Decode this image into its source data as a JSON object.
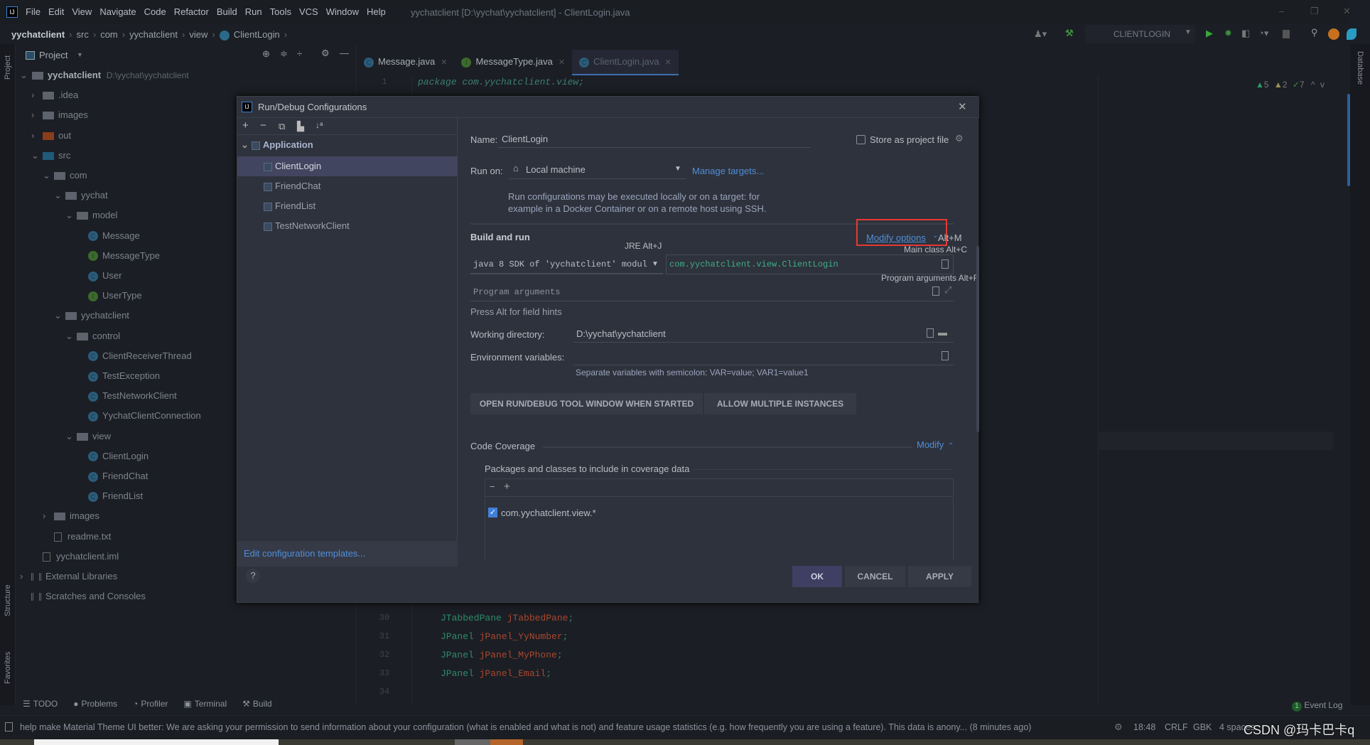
{
  "app": {
    "title": "yychatclient [D:\\yychat\\yychatclient] - ClientLogin.java",
    "logo": "IJ"
  },
  "menu": [
    "File",
    "Edit",
    "View",
    "Navigate",
    "Code",
    "Refactor",
    "Build",
    "Run",
    "Tools",
    "VCS",
    "Window",
    "Help"
  ],
  "breadcrumb": [
    "yychatclient",
    "src",
    "com",
    "yychatclient",
    "view",
    "ClientLogin"
  ],
  "toolbar": {
    "run_config": "CLIENTLOGIN"
  },
  "window_controls": {
    "minimize": "–",
    "restore": "❐",
    "close": "✕"
  },
  "project": {
    "title": "Project",
    "strip_label": "Project",
    "root": "yychatclient",
    "root_path": "D:\\yychat\\yychatclient",
    "tree": [
      {
        "label": ".idea",
        "indent": 1,
        "kind": "folder",
        "arrow": ">"
      },
      {
        "label": "images",
        "indent": 1,
        "kind": "folder",
        "arrow": ">"
      },
      {
        "label": "out",
        "indent": 1,
        "kind": "folder-out",
        "arrow": ">"
      },
      {
        "label": "src",
        "indent": 1,
        "kind": "folder-src",
        "arrow": "v"
      },
      {
        "label": "com",
        "indent": 2,
        "kind": "package",
        "arrow": "v"
      },
      {
        "label": "yychat",
        "indent": 3,
        "kind": "package",
        "arrow": "v"
      },
      {
        "label": "model",
        "indent": 4,
        "kind": "package",
        "arrow": "v"
      },
      {
        "label": "Message",
        "indent": 5,
        "kind": "class"
      },
      {
        "label": "MessageType",
        "indent": 5,
        "kind": "interface"
      },
      {
        "label": "User",
        "indent": 5,
        "kind": "class"
      },
      {
        "label": "UserType",
        "indent": 5,
        "kind": "interface"
      },
      {
        "label": "yychatclient",
        "indent": 3,
        "kind": "package",
        "arrow": "v"
      },
      {
        "label": "control",
        "indent": 4,
        "kind": "package",
        "arrow": "v"
      },
      {
        "label": "ClientReceiverThread",
        "indent": 5,
        "kind": "class"
      },
      {
        "label": "TestException",
        "indent": 5,
        "kind": "class"
      },
      {
        "label": "TestNetworkClient",
        "indent": 5,
        "kind": "class"
      },
      {
        "label": "YychatClientConnection",
        "indent": 5,
        "kind": "class"
      },
      {
        "label": "view",
        "indent": 4,
        "kind": "package",
        "arrow": "v"
      },
      {
        "label": "ClientLogin",
        "indent": 5,
        "kind": "class"
      },
      {
        "label": "FriendChat",
        "indent": 5,
        "kind": "class"
      },
      {
        "label": "FriendList",
        "indent": 5,
        "kind": "class"
      },
      {
        "label": "images",
        "indent": 2,
        "kind": "package",
        "arrow": ">"
      },
      {
        "label": "readme.txt",
        "indent": 2,
        "kind": "file"
      },
      {
        "label": "yychatclient.iml",
        "indent": 1,
        "kind": "file"
      },
      {
        "label": "External Libraries",
        "indent": 0,
        "kind": "lib",
        "arrow": ">"
      },
      {
        "label": "Scratches and Consoles",
        "indent": 0,
        "kind": "lib"
      }
    ]
  },
  "side_labels": {
    "structure": "Structure",
    "favorites": "Favorites",
    "database": "Database"
  },
  "editor": {
    "tabs": [
      {
        "label": "Message.java",
        "icon": "C"
      },
      {
        "label": "MessageType.java",
        "icon": "I"
      },
      {
        "label": "ClientLogin.java",
        "icon": "C",
        "active": true
      }
    ],
    "inspections": {
      "warnings": "5",
      "weak_warnings": "2",
      "typos": "7"
    },
    "lines": [
      {
        "n": "1",
        "parts": [
          [
            "pk",
            "package com.yychatclient.view;"
          ]
        ]
      },
      {
        "n": "30",
        "parts": [
          [
            "ty",
            "JTabbedPane "
          ],
          [
            "va",
            "jTabbedPane"
          ],
          [
            "pk",
            ";"
          ]
        ]
      },
      {
        "n": "31",
        "parts": [
          [
            "ty",
            "JPanel "
          ],
          [
            "va",
            "jPanel_YyNumber"
          ],
          [
            "pk",
            ";"
          ]
        ]
      },
      {
        "n": "32",
        "parts": [
          [
            "ty",
            "JPanel "
          ],
          [
            "va",
            "jPanel_MyPhone"
          ],
          [
            "pk",
            ";"
          ]
        ]
      },
      {
        "n": "33",
        "parts": [
          [
            "ty",
            "JPanel "
          ],
          [
            "va",
            "jPanel_Email"
          ],
          [
            "pk",
            ";"
          ]
        ]
      },
      {
        "n": "34",
        "parts": []
      }
    ]
  },
  "dialog": {
    "title": "Run/Debug Configurations",
    "group": "Application",
    "configs": [
      "ClientLogin",
      "FriendChat",
      "FriendList",
      "TestNetworkClient"
    ],
    "selected": "ClientLogin",
    "edit_templates": "Edit configuration templates...",
    "name_label": "Name:",
    "name_value": "ClientLogin",
    "store_label": "Store as project file",
    "store_checked": false,
    "run_on_label": "Run on:",
    "run_on_value": "Local machine",
    "manage_targets": "Manage targets...",
    "run_on_info_1": "Run configurations may be executed locally or on a target: for",
    "run_on_info_2": "example in a Docker Container or on a remote host using SSH.",
    "build_run": "Build and run",
    "modify_options": "Modify options",
    "modify_shortcut": "Alt+M",
    "jre_hint": "JRE Alt+J",
    "main_class_hint": "Main class Alt+C",
    "prog_args_hint": "Program arguments Alt+R",
    "jre_value": "java 8 SDK of 'yychatclient' module",
    "main_class": "com.yychatclient.view.ClientLogin",
    "prog_args_placeholder": "Program arguments",
    "press_alt": "Press Alt for field hints",
    "workdir_label": "Working directory:",
    "workdir_value": "D:\\yychat\\yychatclient",
    "env_label": "Environment variables:",
    "env_hint": "Separate variables with semicolon: VAR=value; VAR1=value1",
    "chip_1": "OPEN RUN/DEBUG TOOL WINDOW WHEN STARTED",
    "chip_2": "ALLOW MULTIPLE INSTANCES",
    "coverage_label": "Code Coverage",
    "coverage_modify": "Modify",
    "packages_label": "Packages and classes to include in coverage data",
    "package_entry": "com.yychatclient.view.*",
    "package_checked": true,
    "ok": "OK",
    "cancel": "CANCEL",
    "apply": "APPLY",
    "help": "?"
  },
  "tool_windows": [
    "TODO",
    "Problems",
    "Profiler",
    "Terminal",
    "Build"
  ],
  "event_log": {
    "count": "1",
    "label": "Event Log"
  },
  "status": {
    "message": "help make Material Theme UI better: We are asking your permission to send information about your configuration (what is enabled and what is not) and feature usage statistics (e.g. how frequently you are using a feature). This data is anony... (8 minutes ago)",
    "position": "18:48",
    "line_sep": "CRLF",
    "encoding": "GBK",
    "indent": "4 spaces"
  },
  "watermark": "CSDN @玛卡巴卡q",
  "colors": {
    "accent": "#4f8fd8",
    "highlight_box": "#e53935",
    "selection": "#42455f",
    "ok_button": "#3d3f63"
  }
}
